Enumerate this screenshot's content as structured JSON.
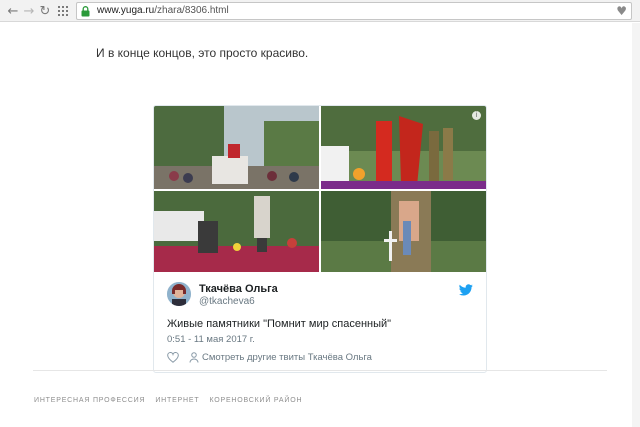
{
  "browser": {
    "url_host": "www.yuga.ru",
    "url_path": "/zhara/8306.html",
    "icons": [
      "back-icon",
      "forward-icon",
      "reload-icon",
      "apps-icon",
      "lock-icon",
      "bookmark-star-icon"
    ]
  },
  "article": {
    "lead_text": "И в конце концов, это просто красиво."
  },
  "tweet": {
    "author_name": "Ткачёва Ольга",
    "author_handle": "@tkacheva6",
    "text": "Живые памятники \"Помнит мир спасенный\"",
    "time": "0:51 - 11 мая 2017 г.",
    "more_link": "Смотреть другие твиты Ткачёва Ольга",
    "info_symbol": "i",
    "accent_color": "#1da1f2"
  },
  "tags": [
    {
      "label": "Интересная профессия"
    },
    {
      "label": "Интернет"
    },
    {
      "label": "Кореновский район"
    }
  ]
}
